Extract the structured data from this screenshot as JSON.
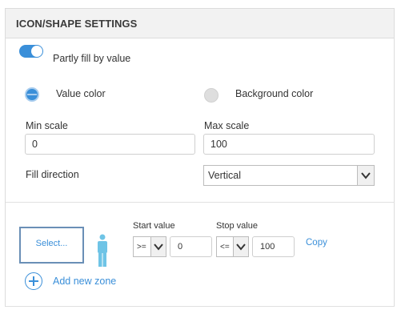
{
  "panel": {
    "title": "ICON/SHAPE SETTINGS"
  },
  "toggle": {
    "label": "Partly fill by value",
    "on": true
  },
  "fill_color": {
    "options": [
      {
        "label": "Value color",
        "selected": true
      },
      {
        "label": "Background color",
        "selected": false
      }
    ]
  },
  "scale": {
    "min_label": "Min scale",
    "min_value": "0",
    "max_label": "Max scale",
    "max_value": "100"
  },
  "fill_direction": {
    "label": "Fill direction",
    "value": "Vertical"
  },
  "zone": {
    "select_label": "Select...",
    "start_label": "Start value",
    "start_operator": ">=",
    "start_value": "0",
    "stop_label": "Stop value",
    "stop_operator": "<=",
    "stop_value": "100",
    "copy_label": "Copy",
    "add_label": "Add new zone",
    "icon": "person-icon"
  },
  "colors": {
    "accent": "#3a8fd9",
    "person": "#6fc4e6"
  }
}
